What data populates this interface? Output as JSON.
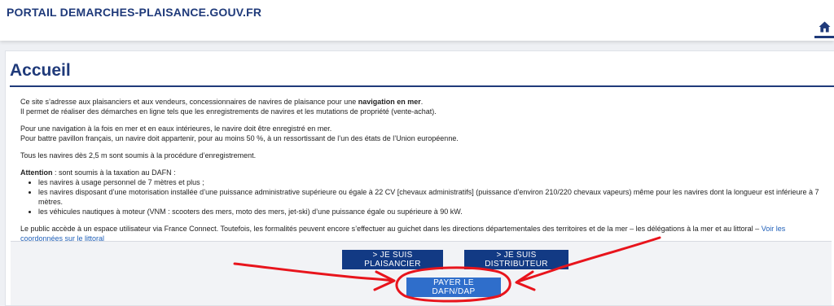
{
  "header": {
    "site_title": "PORTAIL DEMARCHES-PLAISANCE.GOUV.FR",
    "home_icon": "home-icon"
  },
  "page": {
    "title": "Accueil",
    "intro_line1_prefix": "Ce site s’adresse aux plaisanciers et aux vendeurs, concessionnaires de navires de plaisance pour une ",
    "intro_line1_bold": "navigation en mer",
    "intro_line1_suffix": ".",
    "intro_line2": "Il permet de réaliser des démarches en ligne tels que les enregistrements de navires et les mutations de propriété (vente-achat).",
    "navigation_line1": "Pour une navigation à la fois en mer et en eaux intérieures, le navire doit être enregistré en mer.",
    "navigation_line2": "Pour battre pavillon français, un navire doit appartenir, pour au moins 50 %, à un ressortissant de l’un des états de l’Union européenne.",
    "registration_line": "Tous les navires dès 2,5 m sont soumis à la procédure d’enregistrement.",
    "attention_label": "Attention",
    "attention_text": " : sont soumis à la taxation au DAFN :",
    "taxation_items": [
      "les navires à usage personnel de 7 mètres et plus ;",
      "les navires disposant d’une motorisation installée d’une puissance administrative supérieure ou égale à 22 CV [chevaux administratifs] (puissance d’environ 210/220 chevaux vapeurs) même pour les navires dont la longueur est inférieure à 7 mètres.",
      "les véhicules nautiques à moteur (VNM : scooters des mers, moto des mers, jet-ski) d’une puissance égale ou supérieure à 90 kW."
    ],
    "public_text": "Le public accède à un espace utilisateur via France Connect. Toutefois, les formalités peuvent encore s’effectuer au guichet dans les directions départementales des territoires et de la mer – les délégations à la mer et au littoral – ",
    "public_link": "Voir les coordonnées sur le littoral"
  },
  "actions": {
    "plaisancier_label": "> JE SUIS PLAISANCIER",
    "distributeur_label": "> JE SUIS DISTRIBUTEUR",
    "payer_label": "PAYER LE DAFN/DAP"
  },
  "colors": {
    "primary": "#123a84",
    "payer_button": "#2f6ecb",
    "annotation": "#e8141c"
  }
}
